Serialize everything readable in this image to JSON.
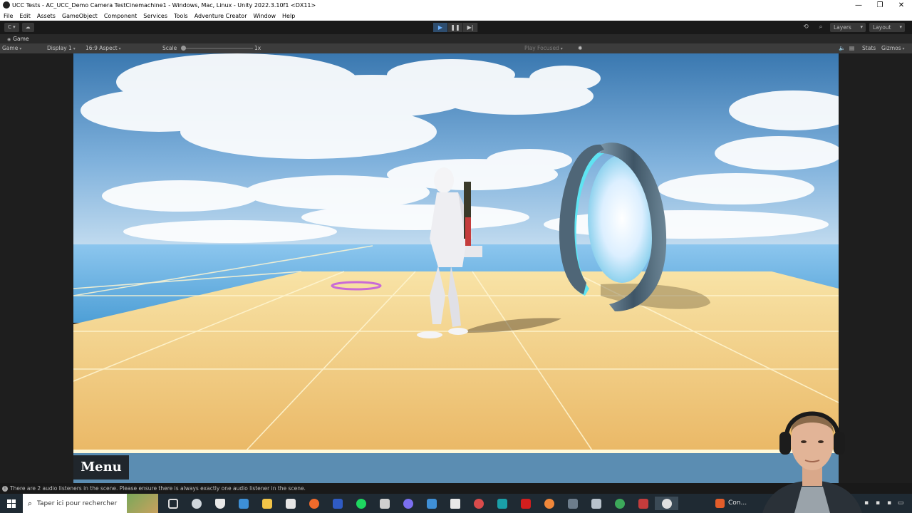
{
  "window": {
    "title": "UCC Tests - AC_UCC_Demo Camera TestCinemachine1 - Windows, Mac, Linux - Unity 2022.3.10f1 <DX11>",
    "controls": [
      "—",
      "❐",
      "✕"
    ]
  },
  "menubar": {
    "items": [
      "File",
      "Edit",
      "Assets",
      "GameObject",
      "Component",
      "Services",
      "Tools",
      "Adventure Creator",
      "Window",
      "Help"
    ]
  },
  "toolbar": {
    "account_label": "C ▾",
    "cloud_icon": "cloud-icon",
    "play_icon": "▶",
    "pause_icon": "❚❚",
    "step_icon": "▶|",
    "history_icon": "⟲",
    "search_icon": "⌕",
    "layers_label": "Layers",
    "layout_label": "Layout"
  },
  "game_tab": {
    "label": "Game"
  },
  "game_toolbar": {
    "view_mode": "Game",
    "display": "Display 1",
    "aspect": "16:9 Aspect",
    "scale_label": "Scale",
    "scale_value": "1x",
    "play_focused": "Play Focused",
    "stats": "Stats",
    "gizmos": "Gizmos"
  },
  "game": {
    "menu_label": "Menu"
  },
  "status": {
    "message": "There are 2 audio listeners in the scene. Please ensure there is always exactly one audio listener in the scene."
  },
  "taskbar": {
    "search_placeholder": "Taper ici pour rechercher",
    "running_app": "Con..."
  },
  "colors": {
    "sky_top": "#2f6fa8",
    "floor": "#f0c774",
    "ocean": "#6fb6e6",
    "portal": "#4f6677",
    "portal_glow": "#5fe4f2",
    "play_active": "#2e4d6e"
  }
}
